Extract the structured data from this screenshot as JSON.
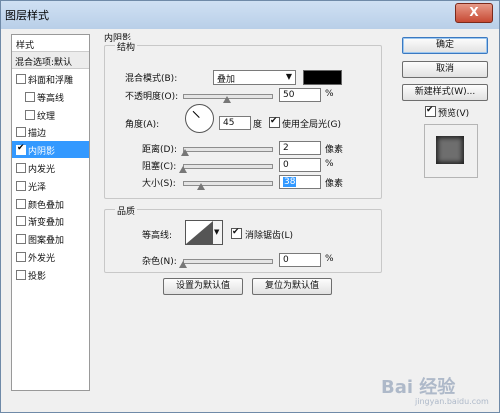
{
  "window": {
    "title": "图层样式",
    "close": "X"
  },
  "list": {
    "header": "样式",
    "blend_options": "混合选项:默认",
    "items": [
      {
        "label": "斜面和浮雕",
        "checked": false,
        "indent": false
      },
      {
        "label": "等高线",
        "checked": false,
        "indent": true
      },
      {
        "label": "纹理",
        "checked": false,
        "indent": true
      },
      {
        "label": "描边",
        "checked": false,
        "indent": false
      },
      {
        "label": "内阴影",
        "checked": true,
        "indent": false,
        "selected": true
      },
      {
        "label": "内发光",
        "checked": false,
        "indent": false
      },
      {
        "label": "光泽",
        "checked": false,
        "indent": false
      },
      {
        "label": "颜色叠加",
        "checked": false,
        "indent": false
      },
      {
        "label": "渐变叠加",
        "checked": false,
        "indent": false
      },
      {
        "label": "图案叠加",
        "checked": false,
        "indent": false
      },
      {
        "label": "外发光",
        "checked": false,
        "indent": false
      },
      {
        "label": "投影",
        "checked": false,
        "indent": false
      }
    ]
  },
  "panel": {
    "title": "内阴影",
    "structure": {
      "legend": "结构",
      "blend_mode_label": "混合模式(B):",
      "blend_mode_value": "叠加",
      "opacity_label": "不透明度(O):",
      "opacity_value": "50",
      "opacity_unit": "%",
      "opacity_level": 0.5,
      "angle_label": "角度(A):",
      "angle_value": "45",
      "angle_unit": "度",
      "global_light_label": "使用全局光(G)",
      "global_light_checked": true,
      "distance_label": "距离(D):",
      "distance_value": "2",
      "distance_unit": "像素",
      "choke_label": "阻塞(C):",
      "choke_value": "0",
      "choke_unit": "%",
      "size_label": "大小(S):",
      "size_value": "38",
      "size_unit": "像素"
    },
    "quality": {
      "legend": "品质",
      "contour_label": "等高线:",
      "antialias_label": "消除锯齿(L)",
      "antialias_checked": true,
      "noise_label": "杂色(N):",
      "noise_value": "0",
      "noise_unit": "%"
    },
    "make_default": "设置为默认值",
    "reset_default": "复位为默认值"
  },
  "right": {
    "ok": "确定",
    "cancel": "取消",
    "new_style": "新建样式(W)...",
    "preview_label": "预览(V)",
    "preview_checked": true
  },
  "colors": {
    "selection": "#3399ff",
    "shadow_color": "#000000"
  },
  "watermark": {
    "text": "Bai 经验",
    "sub": "jingyan.baidu.com"
  }
}
